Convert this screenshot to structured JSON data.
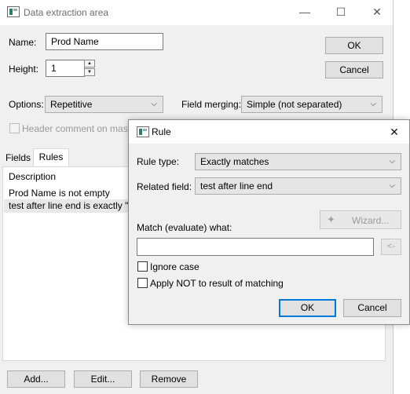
{
  "main_window": {
    "title": "Data extraction area",
    "caption_buttons": {
      "minimize": "—",
      "maximize": "☐",
      "close": "✕"
    },
    "name_label": "Name:",
    "name_value": "Prod Name",
    "height_label": "Height:",
    "height_value": "1",
    "ok_label": "OK",
    "cancel_label": "Cancel",
    "options_label": "Options:",
    "options_value": "Repetitive",
    "field_merging_label": "Field merging:",
    "field_merging_value": "Simple (not separated)",
    "header_comment_label": "Header comment on master",
    "tabs": [
      {
        "label": "Fields"
      },
      {
        "label": "Rules"
      }
    ],
    "rules_panel": {
      "description_header": "Description",
      "rows": [
        "Prod Name is not empty",
        "test after line end is exactly \""
      ]
    },
    "bottom_buttons": {
      "add": "Add...",
      "edit": "Edit...",
      "remove": "Remove"
    }
  },
  "rule_dialog": {
    "title": "Rule",
    "close": "✕",
    "rule_type_label": "Rule type:",
    "rule_type_value": "Exactly matches",
    "related_field_label": "Related field:",
    "related_field_value": "test after line end",
    "wizard_label": "Wizard...",
    "match_label": "Match (evaluate) what:",
    "match_value": "",
    "insert_label": "<-",
    "ignore_case_label": "Ignore case",
    "apply_not_label": "Apply NOT to result of matching",
    "ok_label": "OK",
    "cancel_label": "Cancel"
  },
  "icons": {
    "dropdown": "chevron-down-icon",
    "app": "app-icon",
    "wand": "wand-icon"
  },
  "colors": {
    "accent": "#0078d7",
    "window_bg": "#f0f0f0",
    "selection_bg": "#e8e8e8"
  }
}
